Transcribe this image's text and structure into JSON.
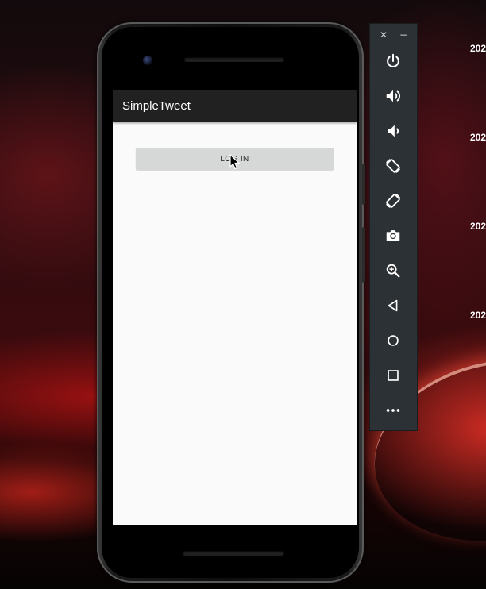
{
  "app": {
    "title": "SimpleTweet",
    "login_label": "LOG IN"
  },
  "desktop": {
    "clock_labels": [
      "202",
      "202",
      "202",
      "202"
    ]
  },
  "emulator_toolbar": {
    "close_glyph": "✕",
    "minimize_glyph": "−",
    "buttons": [
      {
        "name": "power-icon"
      },
      {
        "name": "volume-up-icon"
      },
      {
        "name": "volume-down-icon"
      },
      {
        "name": "rotate-left-icon"
      },
      {
        "name": "rotate-right-icon"
      },
      {
        "name": "camera-icon"
      },
      {
        "name": "zoom-icon"
      },
      {
        "name": "back-icon"
      },
      {
        "name": "home-icon"
      },
      {
        "name": "overview-icon"
      },
      {
        "name": "more-icon"
      }
    ]
  },
  "colors": {
    "app_bar": "#212121",
    "screen_bg": "#fafafa",
    "button_bg": "#d6d7d7",
    "toolbar_bg": "#2c3136"
  }
}
